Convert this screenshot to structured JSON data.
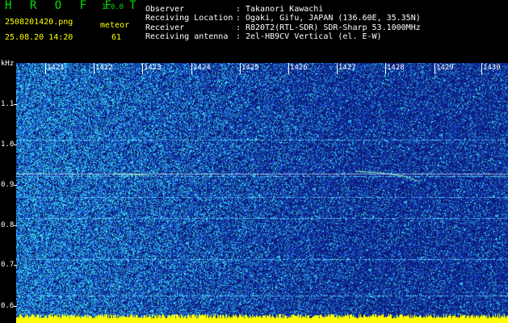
{
  "header": {
    "app_title": "H R O F F T",
    "app_version": "1.0.0",
    "file_name": "2508201420.png",
    "datetime": "25.08.20 14:20",
    "meteor_label": "meteor",
    "meteor_count": "61",
    "info": [
      {
        "key": "Observer",
        "value": "Takanori Kawachi"
      },
      {
        "key": "Receiving Location",
        "value": "Ogaki, Gifu, JAPAN (136.60E, 35.35N)"
      },
      {
        "key": "Receiver",
        "value": "R820T2(RTL-SDR) SDR-Sharp 53.1000MHz"
      },
      {
        "key": "Receiving antenna",
        "value": "2el-HB9CV Vertical (el. E-W)"
      }
    ]
  },
  "spectrogram": {
    "y_unit": "kHz",
    "y_ticks": [
      "1.1",
      "1.0",
      "0.9",
      "0.8",
      "0.7",
      "0.6"
    ],
    "x_ticks": [
      "1421",
      "1422",
      "1423",
      "1424",
      "1425",
      "1426",
      "1427",
      "1428",
      "1429",
      "1430"
    ],
    "colors": {
      "background": "#000000",
      "noise_low": "#0a1a8a",
      "noise_mid": "#1f5ce0",
      "noise_high": "#33d8f0",
      "trace": "#7fffb0",
      "bottom_band": "#ffff00",
      "text": "#ffffff"
    }
  }
}
